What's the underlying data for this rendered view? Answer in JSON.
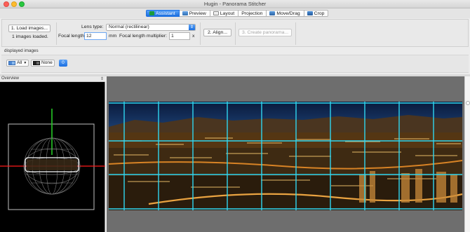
{
  "window": {
    "title": "Hugin - Panorama Stitcher"
  },
  "tabs": [
    {
      "label": "Assistant",
      "icon": "assistant-icon",
      "active": true
    },
    {
      "label": "Preview",
      "icon": "preview-icon"
    },
    {
      "label": "Layout",
      "icon": "layout-icon"
    },
    {
      "label": "Projection",
      "icon": ""
    },
    {
      "label": "Move/Drag",
      "icon": "move-drag-icon"
    },
    {
      "label": "Crop",
      "icon": "crop-icon"
    }
  ],
  "assistant": {
    "load_button": "1. Load images...",
    "images_loaded": "1 images loaded.",
    "lens_type_label": "Lens type:",
    "lens_type_value": "Normal (rectilinear)",
    "focal_length_label": "Focal length:",
    "focal_length_value": "12",
    "focal_length_unit": "mm",
    "multiplier_label": "Focal length multiplier:",
    "multiplier_value": "1",
    "multiplier_suffix": "x",
    "align_button": "2. Align...",
    "create_button": "3. Create panorama..."
  },
  "displayed_images": {
    "label": "displayed images",
    "all_button": "All",
    "none_button": "None",
    "image_index": "0"
  },
  "overview": {
    "label": "Overview"
  },
  "colors": {
    "accent": "#1b6fe0",
    "grid_line": "#2fd6f0",
    "crosshair_red": "#ff1a1a",
    "crosshair_green": "#26c826"
  }
}
